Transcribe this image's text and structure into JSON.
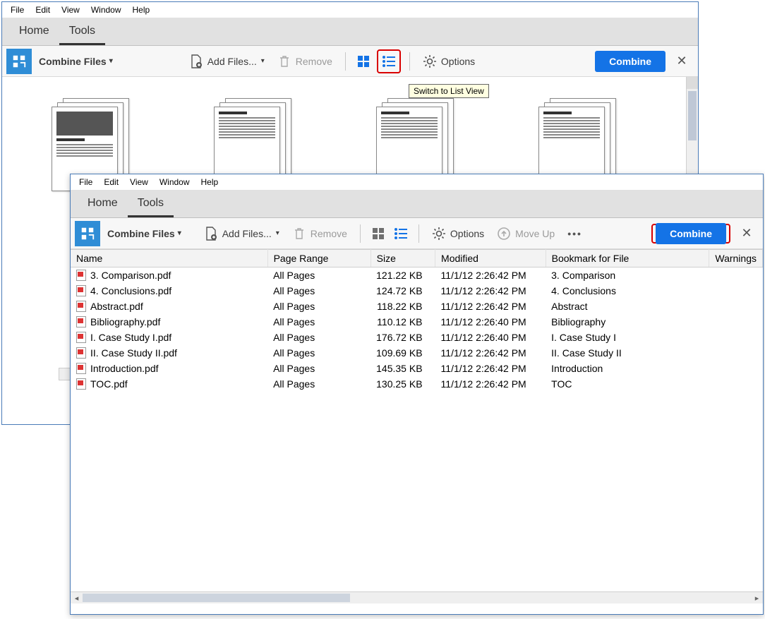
{
  "menu": {
    "file": "File",
    "edit": "Edit",
    "view": "View",
    "window": "Window",
    "help": "Help"
  },
  "tabs": {
    "home": "Home",
    "tools": "Tools"
  },
  "toolbar": {
    "title": "Combine Files",
    "add_files": "Add Files...",
    "remove": "Remove",
    "options": "Options",
    "move_up": "Move Up",
    "combine": "Combine"
  },
  "tooltip": "Switch to List View",
  "columns": {
    "name": "Name",
    "page_range": "Page Range",
    "size": "Size",
    "modified": "Modified",
    "bookmark": "Bookmark for File",
    "warnings": "Warnings"
  },
  "files": [
    {
      "name": "3. Comparison.pdf",
      "range": "All Pages",
      "size": "121.22 KB",
      "modified": "11/1/12 2:26:42 PM",
      "bookmark": "3. Comparison"
    },
    {
      "name": "4. Conclusions.pdf",
      "range": "All Pages",
      "size": "124.72 KB",
      "modified": "11/1/12 2:26:42 PM",
      "bookmark": "4. Conclusions"
    },
    {
      "name": "Abstract.pdf",
      "range": "All Pages",
      "size": "118.22 KB",
      "modified": "11/1/12 2:26:42 PM",
      "bookmark": "Abstract"
    },
    {
      "name": "Bibliography.pdf",
      "range": "All Pages",
      "size": "110.12 KB",
      "modified": "11/1/12 2:26:40 PM",
      "bookmark": "Bibliography"
    },
    {
      "name": "I. Case Study I.pdf",
      "range": "All Pages",
      "size": "176.72 KB",
      "modified": "11/1/12 2:26:40 PM",
      "bookmark": "I. Case Study I"
    },
    {
      "name": "II. Case Study II.pdf",
      "range": "All Pages",
      "size": "109.69 KB",
      "modified": "11/1/12 2:26:42 PM",
      "bookmark": "II. Case Study II"
    },
    {
      "name": "Introduction.pdf",
      "range": "All Pages",
      "size": "145.35 KB",
      "modified": "11/1/12 2:26:42 PM",
      "bookmark": "Introduction"
    },
    {
      "name": "TOC.pdf",
      "range": "All Pages",
      "size": "130.25 KB",
      "modified": "11/1/12 2:26:42 PM",
      "bookmark": "TOC"
    }
  ]
}
